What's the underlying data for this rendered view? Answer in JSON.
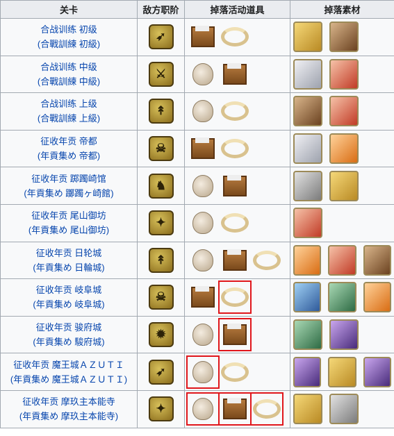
{
  "headers": {
    "stage": "关卡",
    "class": "敌方职阶",
    "drop_event": "掉落活动道具",
    "drop_material": "掉落素材"
  },
  "rows": [
    {
      "l1": "合战训练 初级",
      "l2": "(合戰訓練 初級)",
      "class_icon": "archer-class-icon",
      "drops": [
        {
          "t": "box",
          "hl": false
        },
        {
          "t": "rope",
          "hl": false
        }
      ],
      "mats": [
        "gold",
        "brown"
      ]
    },
    {
      "l1": "合战训练 中级",
      "l2": "(合戰訓練 中級)",
      "class_icon": "saber-class-icon",
      "drops": [
        {
          "t": "bag",
          "hl": false
        },
        {
          "t": "box",
          "hl": false
        }
      ],
      "mats": [
        "silver",
        "red"
      ]
    },
    {
      "l1": "合战训练 上级",
      "l2": "(合戰訓練 上級)",
      "class_icon": "lancer-class-icon",
      "drops": [
        {
          "t": "bag",
          "hl": false
        },
        {
          "t": "rope",
          "hl": false
        }
      ],
      "mats": [
        "brown",
        "red"
      ]
    },
    {
      "l1": "征收年贡 帝都",
      "l2": "(年貢集め 帝都)",
      "class_icon": "assassin-class-icon",
      "drops": [
        {
          "t": "box",
          "hl": false
        },
        {
          "t": "rope",
          "hl": false
        }
      ],
      "mats": [
        "silver",
        "orange"
      ]
    },
    {
      "l1": "征收年贡 踯躅崎馆",
      "l2": "(年貢集め 躑躅ヶ崎館)",
      "class_icon": "rider-class-icon",
      "drops": [
        {
          "t": "bag",
          "hl": false
        },
        {
          "t": "box",
          "hl": false
        }
      ],
      "mats": [
        "grey",
        "gold"
      ]
    },
    {
      "l1": "征收年贡 尾山御坊",
      "l2": "(年貢集め 尾山御坊)",
      "class_icon": "caster-class-icon",
      "drops": [
        {
          "t": "bag",
          "hl": false
        },
        {
          "t": "rope",
          "hl": false
        }
      ],
      "mats": [
        "red"
      ]
    },
    {
      "l1": "征收年贡 日轮城",
      "l2": "(年貢集め 日輪城)",
      "class_icon": "lancer-class-icon",
      "drops": [
        {
          "t": "bag",
          "hl": false
        },
        {
          "t": "box",
          "hl": false
        },
        {
          "t": "rope",
          "hl": false
        }
      ],
      "mats": [
        "orange",
        "red",
        "brown"
      ]
    },
    {
      "l1": "征收年贡 岐阜城",
      "l2": "(年貢集め 岐阜城)",
      "class_icon": "assassin-class-icon",
      "drops": [
        {
          "t": "box",
          "hl": false
        },
        {
          "t": "rope",
          "hl": true
        }
      ],
      "mats": [
        "blue",
        "green",
        "orange"
      ]
    },
    {
      "l1": "征收年贡 骏府城",
      "l2": "(年貢集め 駿府城)",
      "class_icon": "berserker-class-icon",
      "drops": [
        {
          "t": "bag",
          "hl": false
        },
        {
          "t": "box",
          "hl": true
        }
      ],
      "mats": [
        "green",
        "purple"
      ]
    },
    {
      "l1": "征收年贡 魔王城ＡＺＵＴＩ",
      "l2": "(年貢集め 魔王城ＡＺＵＴＩ)",
      "class_icon": "archer-class-icon",
      "drops": [
        {
          "t": "bag",
          "hl": true
        },
        {
          "t": "rope",
          "hl": false
        }
      ],
      "mats": [
        "purple",
        "gold",
        "purple"
      ]
    },
    {
      "l1": "征收年贡 摩玖主本能寺",
      "l2": "(年貢集め 摩玖主本能寺)",
      "class_icon": "caster-class-icon",
      "drops": [
        {
          "t": "bag",
          "hl": true
        },
        {
          "t": "box",
          "hl": true
        },
        {
          "t": "rope",
          "hl": true
        }
      ],
      "mats": [
        "gold",
        "grey"
      ]
    }
  ]
}
